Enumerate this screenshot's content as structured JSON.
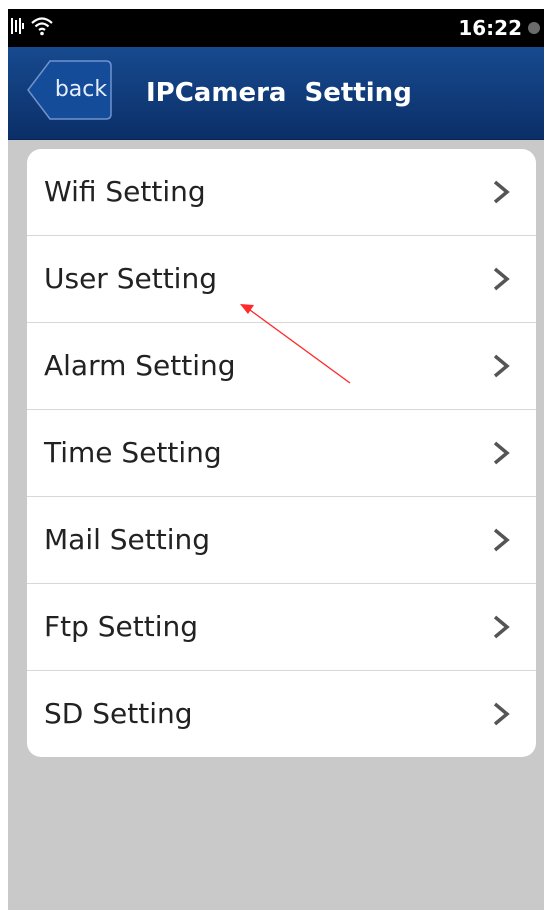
{
  "status_bar": {
    "time": "16:22",
    "icons": [
      "signal-icon",
      "wifi-icon",
      "notification-dot-icon"
    ]
  },
  "header": {
    "back_label": "back",
    "title": "IPCamera  Setting"
  },
  "settings": {
    "items": [
      {
        "label": "Wifi Setting",
        "icon": "chevron-right-icon"
      },
      {
        "label": "User Setting",
        "icon": "chevron-right-icon"
      },
      {
        "label": "Alarm Setting",
        "icon": "chevron-right-icon"
      },
      {
        "label": "Time Setting",
        "icon": "chevron-right-icon"
      },
      {
        "label": "Mail Setting",
        "icon": "chevron-right-icon"
      },
      {
        "label": "Ftp Setting",
        "icon": "chevron-right-icon"
      },
      {
        "label": "SD Setting",
        "icon": "chevron-right-icon"
      }
    ]
  },
  "annotation": {
    "color": "#ff2a2a"
  },
  "colors": {
    "header_top": "#174a8f",
    "header_bottom": "#0b2f68",
    "background": "#c9c9c9",
    "card": "#ffffff"
  }
}
